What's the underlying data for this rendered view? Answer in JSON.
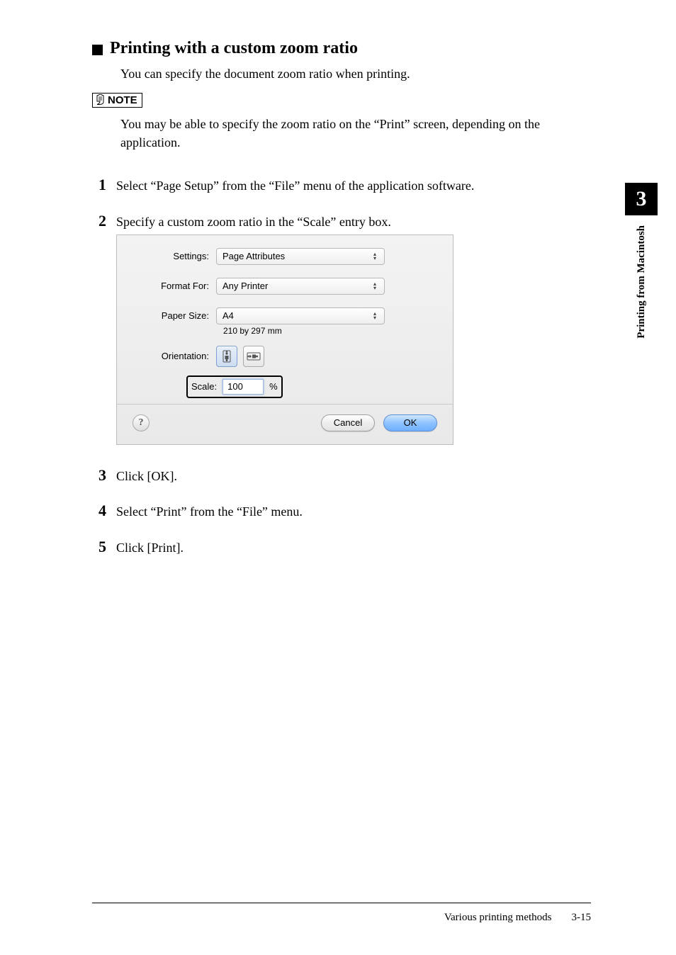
{
  "side": {
    "chapter_num": "3",
    "chapter_title": "Printing from Macintosh"
  },
  "heading": "Printing with a custom zoom ratio",
  "intro": "You can specify the document zoom ratio when printing.",
  "note": {
    "label": "NOTE",
    "body": "You may be able to specify the zoom ratio on the “Print” screen, depending on the application."
  },
  "steps": {
    "s1_num": "1",
    "s1_text": "Select “Page Setup” from the “File” menu of the application software.",
    "s2_num": "2",
    "s2_text": "Specify a custom zoom ratio in the “Scale” entry box.",
    "s3_num": "3",
    "s3_text": "Click [OK].",
    "s4_num": "4",
    "s4_text": "Select “Print” from the “File” menu.",
    "s5_num": "5",
    "s5_text": "Click [Print]."
  },
  "dialog": {
    "settings_label": "Settings:",
    "settings_value": "Page Attributes",
    "format_for_label": "Format For:",
    "format_for_value": "Any Printer",
    "paper_size_label": "Paper Size:",
    "paper_size_value": "A4",
    "paper_size_sub": "210 by 297 mm",
    "orientation_label": "Orientation:",
    "scale_label": "Scale:",
    "scale_value": "100",
    "scale_pct": "%",
    "help": "?",
    "cancel": "Cancel",
    "ok": "OK"
  },
  "footer": {
    "section": "Various printing methods",
    "page": "3-15"
  }
}
